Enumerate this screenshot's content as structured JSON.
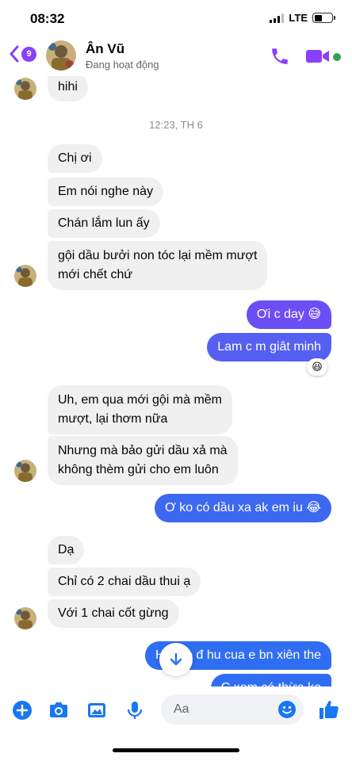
{
  "status_bar": {
    "time": "08:32",
    "network": "LTE"
  },
  "header": {
    "unread_count": "9",
    "contact_name": "Ân Vũ",
    "contact_status": "Đang hoạt động"
  },
  "conversation": {
    "time_separator": "12:23, TH 6",
    "messages": [
      {
        "sender": "them",
        "text": "hihi"
      },
      {
        "sender": "them",
        "text": "Chị ơi"
      },
      {
        "sender": "them",
        "text": "Em nói nghe này"
      },
      {
        "sender": "them",
        "text": "Chán lắm lun ấy"
      },
      {
        "sender": "them",
        "line1": "gội dầu bưởi non tóc lại mềm mượt",
        "line2": "mới chết chứ"
      },
      {
        "sender": "me",
        "text": "Ơi c day 😅"
      },
      {
        "sender": "me",
        "text": "Lam c m giât minh",
        "reaction": "😆"
      },
      {
        "sender": "them",
        "line1": "Uh, em qua mới gội mà mềm",
        "line2": "mượt, lại thơm nữa"
      },
      {
        "sender": "them",
        "line1": "Nhưng mà bảo gửi dầu xả mà",
        "line2": "không thèm gửi cho em luôn"
      },
      {
        "sender": "me",
        "text": "Ơ ko có dầu xa ak em iu 😂"
      },
      {
        "sender": "them",
        "text": "Dạ"
      },
      {
        "sender": "them",
        "text": "Chỉ có 2 chai dầu thui ạ"
      },
      {
        "sender": "them",
        "text": "Với 1 chai cốt gừng"
      },
      {
        "sender": "me",
        "text": "Hụ the đ   hu cua e bn xiên the"
      },
      {
        "sender": "me",
        "text": "C xem có thừa ko"
      }
    ]
  },
  "composer": {
    "placeholder": "Aa"
  },
  "colors": {
    "accent": "#8a3ffc",
    "outgoing_top": "#6b4ef5",
    "outgoing_bottom": "#2f6ef2",
    "incoming": "#f0f0f0",
    "online": "#31a24c",
    "composer_icons": "#1877f2"
  },
  "icons": [
    "back-chevron-icon",
    "phone-icon",
    "video-camera-icon",
    "plus-icon",
    "camera-icon",
    "image-icon",
    "microphone-icon",
    "emoji-icon",
    "thumbs-up-icon",
    "arrow-down-icon"
  ]
}
